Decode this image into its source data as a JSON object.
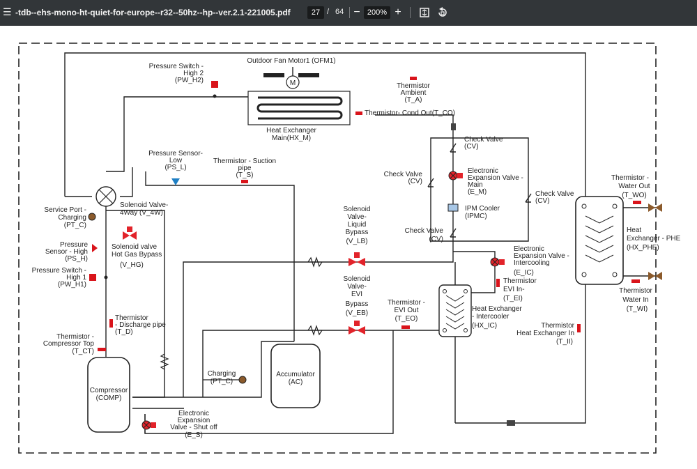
{
  "toolbar": {
    "menu_icon": "hamburger-menu-icon",
    "title": "-tdb--ehs-mono-ht-quiet-for-europe--r32--50hz--hp--ver.2.1-221005.pdf",
    "page_current": "27",
    "page_separator": "/",
    "page_total": "64",
    "zoom_out": "−",
    "zoom": "200%",
    "zoom_in": "+",
    "fit_icon": "fit-to-page-icon",
    "rotate_icon": "rotate-icon"
  },
  "diagram": {
    "ofm1": "Outdoor Fan Motor1 (OFM1)",
    "motor_symbol": "M",
    "pw_h2": [
      "Pressure Switch -",
      "High 2",
      "(PW_H2)"
    ],
    "t_a": [
      "Thermistor",
      "Ambient",
      "(T_A)"
    ],
    "t_co": "Thermistor-  Cond Out(T_CO)",
    "hx_m": [
      "Heat Exchanger",
      "Main(HX_M)"
    ],
    "check_valve_1": [
      "Check Valve",
      "(CV)"
    ],
    "ps_l": [
      "Pressure Sensor-",
      "Low",
      "(PS_L)"
    ],
    "t_s": [
      "Thermistor - Suction",
      "pipe",
      "(T_S)"
    ],
    "check_valve_2": [
      "Check Valve",
      "(CV)"
    ],
    "e_m": [
      "Electronic",
      "Expansion Valve -",
      "Main",
      "(E_M)"
    ],
    "check_valve_3": [
      "Check Valve",
      "(CV)"
    ],
    "ipmc": [
      "IPM Cooler",
      "(IPMC)"
    ],
    "check_valve_4": [
      "Check Valve",
      "(CV)"
    ],
    "service_port": [
      "Service Port -",
      "Charging",
      "(PT_C)"
    ],
    "v_4w": [
      "Solenoid Valve-",
      "4Way (V_4W)"
    ],
    "ps_h": [
      "Pressure",
      "Sensor - High",
      "(PS_H)"
    ],
    "v_hg": [
      "Solenoid valve",
      "Hot Gas Bypass",
      "(V_HG)"
    ],
    "pw_h1": [
      "Pressure Switch -",
      "High 1",
      "(PW_H1)"
    ],
    "v_lb": [
      "Solenoid",
      "Valve-",
      "Liquid",
      "Bypass",
      "(V_LB)"
    ],
    "e_ic": [
      "Electronic",
      "Expansion Valve -",
      "Intercooling",
      "(E_IC)"
    ],
    "t_ei": [
      "Thermistor",
      "EVI In-",
      "(T_EI)"
    ],
    "v_eb": [
      "Solenoid",
      "Valve-",
      "EVI",
      "Bypass",
      "(V_EB)"
    ],
    "t_eo": [
      "Thermistor -",
      "EVI Out",
      "(T_EO)"
    ],
    "hx_ic": [
      "Heat Exchanger",
      "- Intercooler",
      "(HX_IC)"
    ],
    "t_d": [
      "Thermistor",
      "- Discharge pipe",
      "(T_D)"
    ],
    "t_ct": [
      "Thermistor -",
      "Compressor Top",
      "(T_CT)"
    ],
    "t_ii": [
      "Thermistor",
      "Heat Exchanger In",
      "(T_II)"
    ],
    "t_wo": [
      "Thermistor -",
      "Water Out",
      "(T_WO)"
    ],
    "hx_phe": [
      "Heat",
      "Exchanger - PHE",
      "(HX_PHE)"
    ],
    "t_wi": [
      "Thermistor",
      "Water In",
      "(T_WI)"
    ],
    "comp": [
      "Compressor",
      "(COMP)"
    ],
    "charging": [
      "Charging",
      "(PT_C)"
    ],
    "ac": [
      "Accumulator",
      "(AC)"
    ],
    "e_s": [
      "Electronic",
      "Expansion",
      "Valve - Shut off",
      "(E_S)"
    ],
    "colors": {
      "sensor_red": "#d9141b",
      "ps_blue": "#1f7fc4",
      "port_brown": "#8b5a2b",
      "valve_red": "#e2232a",
      "ipmc_blue": "#a8c7e6",
      "toolbar_bg": "#323639"
    }
  }
}
